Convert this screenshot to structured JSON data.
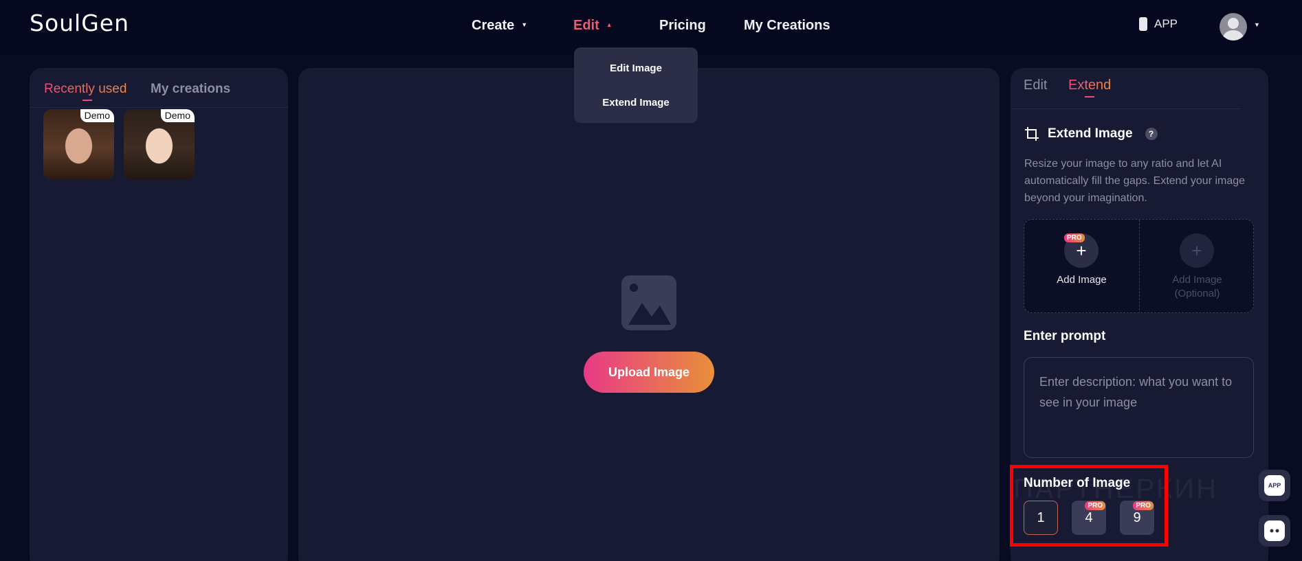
{
  "header": {
    "logo": "SoulGen",
    "nav": {
      "create": "Create",
      "edit": "Edit",
      "pricing": "Pricing",
      "my_creations": "My Creations"
    },
    "app_label": "APP"
  },
  "edit_menu": {
    "items": [
      "Edit Image",
      "Extend Image"
    ]
  },
  "left_panel": {
    "tabs": [
      "Recently used",
      "My creations"
    ],
    "active_tab": "Recently used",
    "thumbnails": [
      {
        "badge": "Demo"
      },
      {
        "badge": "Demo"
      }
    ]
  },
  "center_panel": {
    "upload_button": "Upload Image"
  },
  "right_panel": {
    "tabs": [
      "Edit",
      "Extend"
    ],
    "active_tab": "Extend",
    "section_title": "Extend Image",
    "help_icon": "?",
    "description": "Resize your image to any ratio and let AI automatically fill the gaps. Extend your image beyond your imagination.",
    "add_image": {
      "primary_label": "Add Image",
      "primary_badge": "PRO",
      "secondary_label_line1": "Add Image",
      "secondary_label_line2": "(Optional)"
    },
    "prompt": {
      "title": "Enter prompt",
      "placeholder": "Enter description: what you want to see in your image"
    },
    "number_of_image": {
      "title": "Number of Image",
      "options": [
        {
          "value": "1",
          "badge": ""
        },
        {
          "value": "4",
          "badge": "PRO"
        },
        {
          "value": "9",
          "badge": "PRO"
        }
      ],
      "selected": "1"
    }
  },
  "watermark": "ПАРТНЕРКИН",
  "floating": {
    "app_button": "APP"
  },
  "colors": {
    "background": "#090b22",
    "panel": "#181a34",
    "accent_start": "#e83a86",
    "accent_end": "#e8903a",
    "highlight": "#ff0000"
  }
}
